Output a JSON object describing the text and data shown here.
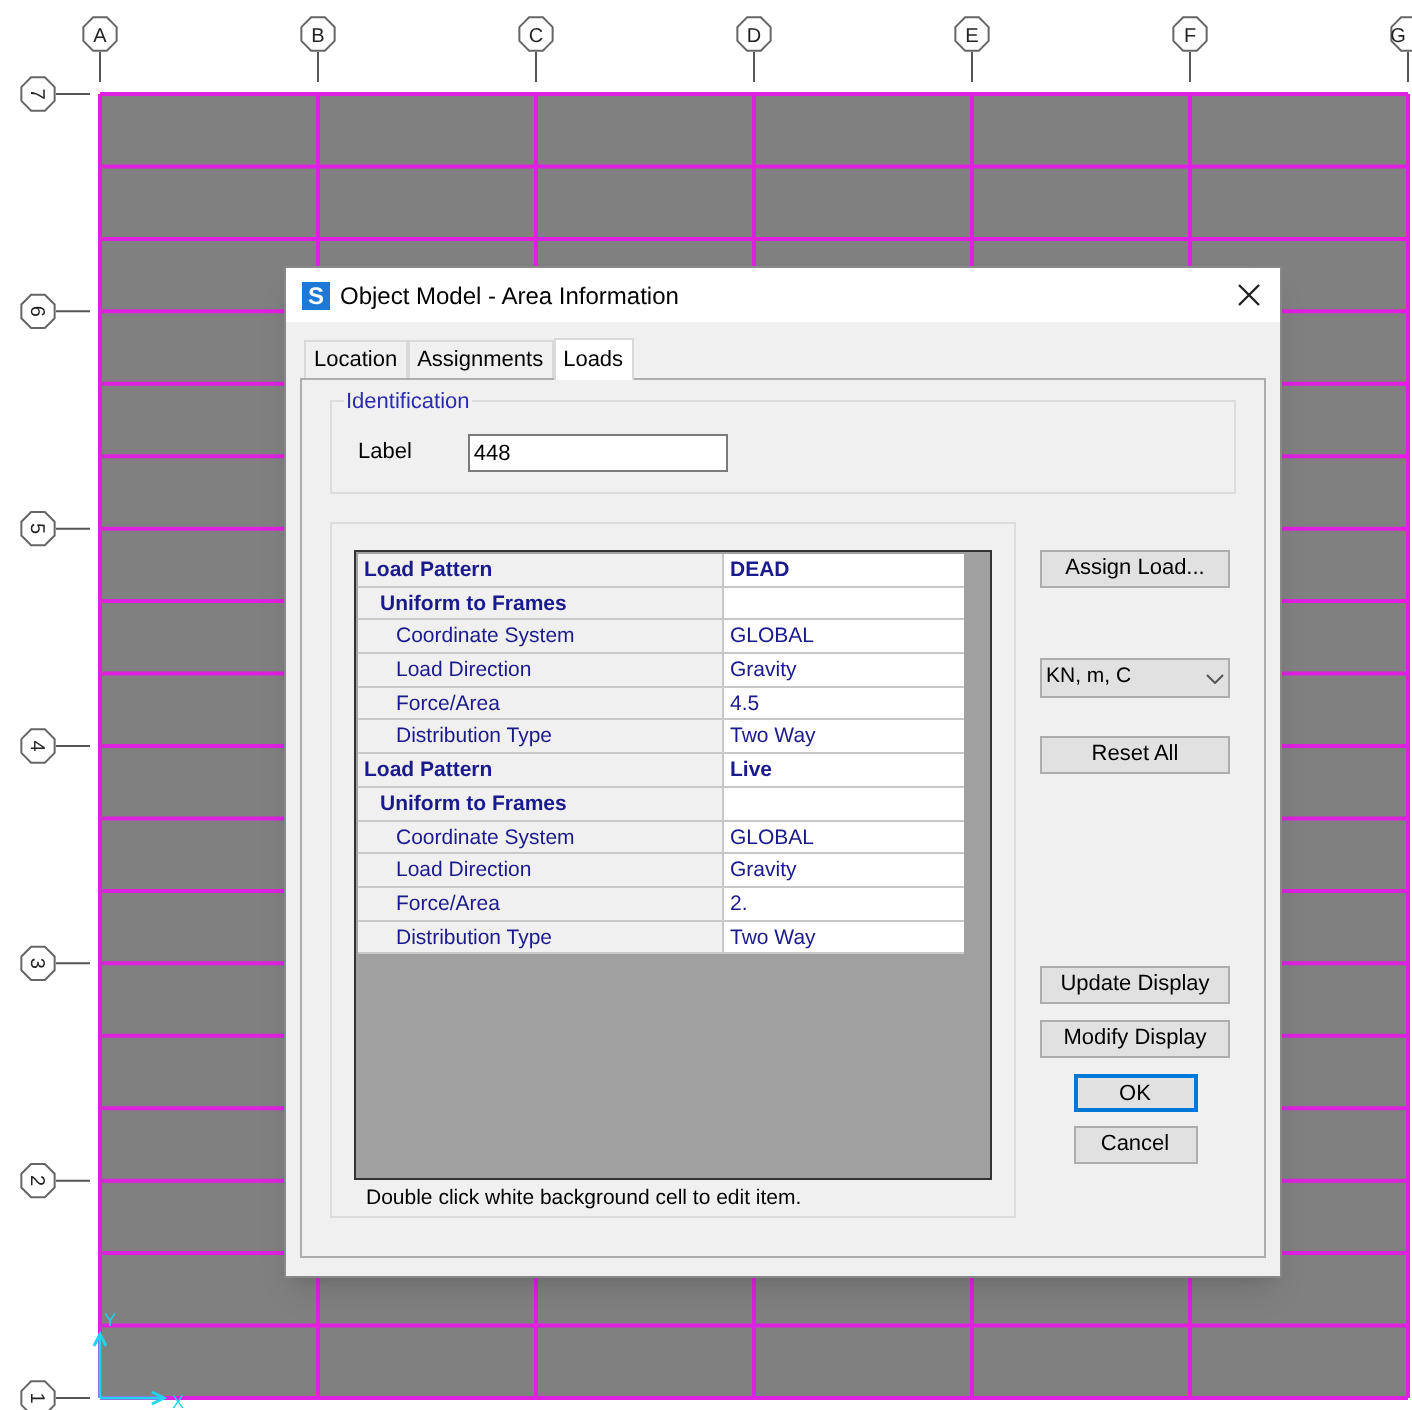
{
  "model_view": {
    "grid_columns": [
      "A",
      "B",
      "C",
      "D",
      "E",
      "F",
      "G"
    ],
    "grid_rows": [
      "7",
      "6",
      "5",
      "4",
      "3",
      "2",
      "1"
    ],
    "axes": {
      "y_label": "Y",
      "x_label": "X"
    }
  },
  "dialog": {
    "title": "Object Model - Area Information",
    "app_icon": "S",
    "tabs": [
      {
        "label": "Location",
        "selected": false
      },
      {
        "label": "Assignments",
        "selected": false
      },
      {
        "label": "Loads",
        "selected": true
      }
    ],
    "identification": {
      "title": "Identification",
      "label": "Label",
      "value": "448"
    },
    "table": {
      "rows": [
        {
          "kind": "pattern",
          "name": "Load Pattern",
          "value": "DEAD"
        },
        {
          "kind": "group",
          "name": "Uniform to Frames",
          "value": ""
        },
        {
          "kind": "property",
          "name": "Coordinate System",
          "value": "GLOBAL"
        },
        {
          "kind": "property",
          "name": "Load Direction",
          "value": "Gravity"
        },
        {
          "kind": "property",
          "name": "Force/Area",
          "value": "4.5"
        },
        {
          "kind": "property",
          "name": "Distribution Type",
          "value": "Two Way"
        },
        {
          "kind": "pattern",
          "name": "Load Pattern",
          "value": "Live"
        },
        {
          "kind": "group",
          "name": "Uniform to Frames",
          "value": ""
        },
        {
          "kind": "property",
          "name": "Coordinate System",
          "value": "GLOBAL"
        },
        {
          "kind": "property",
          "name": "Load Direction",
          "value": "Gravity"
        },
        {
          "kind": "property",
          "name": "Force/Area",
          "value": "2."
        },
        {
          "kind": "property",
          "name": "Distribution Type",
          "value": "Two Way"
        }
      ],
      "hint": "Double click white background cell to edit item."
    },
    "assign_button": "Assign Load...",
    "units": "KN, m, C",
    "reset_button": "Reset All",
    "update_button": "Update Display",
    "modify_button": "Modify Display",
    "ok_button": "OK",
    "cancel_button": "Cancel"
  }
}
